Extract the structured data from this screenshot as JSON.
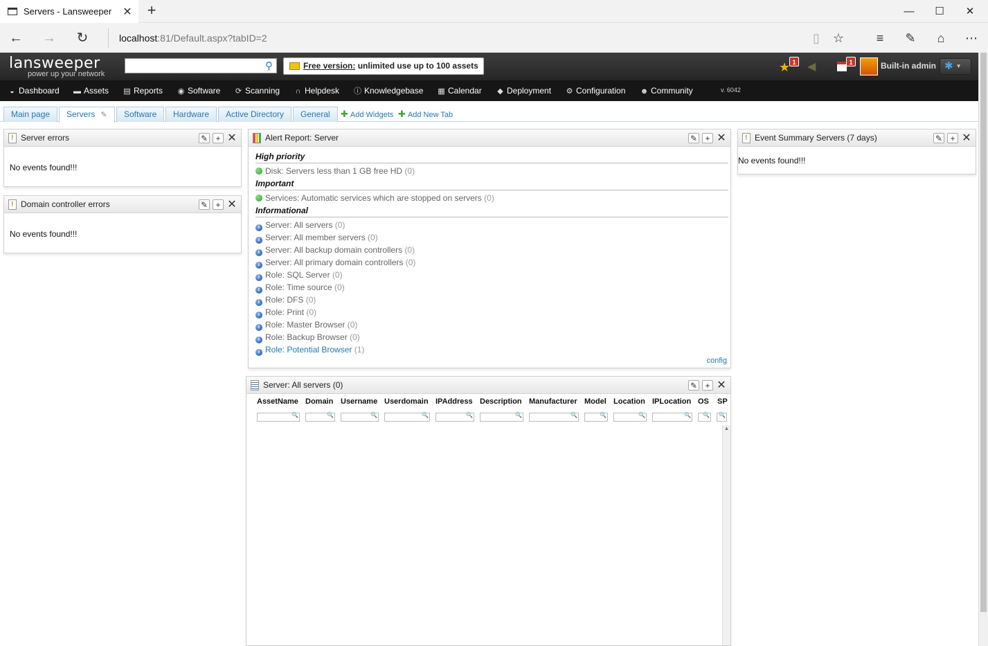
{
  "browser": {
    "tab_title": "Servers - Lansweeper",
    "url_host": "localhost",
    "url_path": ":81/Default.aspx?tabID=2"
  },
  "header": {
    "logo_word": "lansweeper",
    "logo_tagline": "power up your network",
    "search_placeholder": "",
    "free_banner_link": "Free version:",
    "free_banner_text": " unlimited use up to 100 assets",
    "badge_favorites": "1",
    "badge_calendar": "1",
    "user_name": "Built-in admin"
  },
  "menu": {
    "items": [
      {
        "label": "Dashboard",
        "icon": "dashboard-icon"
      },
      {
        "label": "Assets",
        "icon": "monitor-icon"
      },
      {
        "label": "Reports",
        "icon": "report-icon"
      },
      {
        "label": "Software",
        "icon": "software-icon"
      },
      {
        "label": "Scanning",
        "icon": "scanning-icon"
      },
      {
        "label": "Helpdesk",
        "icon": "headset-icon"
      },
      {
        "label": "Knowledgebase",
        "icon": "info-icon"
      },
      {
        "label": "Calendar",
        "icon": "calendar-icon"
      },
      {
        "label": "Deployment",
        "icon": "box-icon"
      },
      {
        "label": "Configuration",
        "icon": "cog-icon"
      },
      {
        "label": "Community",
        "icon": "people-icon"
      }
    ],
    "version": "v. 6042"
  },
  "dash_tabs": {
    "tabs": [
      "Main page",
      "Servers",
      "Software",
      "Hardware",
      "Active Directory",
      "General"
    ],
    "active_index": 1,
    "add_widgets": "Add Widgets",
    "add_new_tab": "Add New Tab"
  },
  "widgets": {
    "server_errors": {
      "title": "Server errors",
      "body": "No events found!!!"
    },
    "dc_errors": {
      "title": "Domain controller errors",
      "body": "No events found!!!"
    },
    "event_summary": {
      "title": "Event Summary Servers (7 days)",
      "body": "No events found!!!"
    },
    "alert_report": {
      "title": "Alert Report: Server",
      "sections": [
        {
          "title": "High priority",
          "rows": [
            {
              "label": "Disk: Servers less than 1 GB free HD",
              "count": "(0)",
              "status": "green"
            }
          ]
        },
        {
          "title": "Important",
          "rows": [
            {
              "label": "Services: Automatic services which are stopped on servers",
              "count": "(0)",
              "status": "green"
            }
          ]
        },
        {
          "title": "Informational",
          "rows": [
            {
              "label": "Server: All servers",
              "count": "(0)",
              "status": "info"
            },
            {
              "label": "Server: All member servers",
              "count": "(0)",
              "status": "info"
            },
            {
              "label": "Server: All backup domain controllers",
              "count": "(0)",
              "status": "info"
            },
            {
              "label": "Server: All primary domain controllers",
              "count": "(0)",
              "status": "info"
            },
            {
              "label": "Role: SQL Server",
              "count": "(0)",
              "status": "info"
            },
            {
              "label": "Role: Time source",
              "count": "(0)",
              "status": "info"
            },
            {
              "label": "Role: DFS",
              "count": "(0)",
              "status": "info"
            },
            {
              "label": "Role: Print",
              "count": "(0)",
              "status": "info"
            },
            {
              "label": "Role: Master Browser",
              "count": "(0)",
              "status": "info"
            },
            {
              "label": "Role: Backup Browser",
              "count": "(0)",
              "status": "info"
            },
            {
              "label": "Role: Potential Browser",
              "count": "(1)",
              "status": "info",
              "link": true
            }
          ]
        }
      ],
      "config": "config"
    },
    "all_servers": {
      "title": "Server: All servers (0)",
      "columns": [
        "AssetName",
        "Domain",
        "Username",
        "Userdomain",
        "IPAddress",
        "Description",
        "Manufacturer",
        "Model",
        "Location",
        "IPLocation",
        "OS",
        "SP"
      ]
    }
  },
  "colors": {
    "accent": "#1f78b4",
    "header_bg": "#2b2b2b",
    "menu_bg": "#161616"
  }
}
